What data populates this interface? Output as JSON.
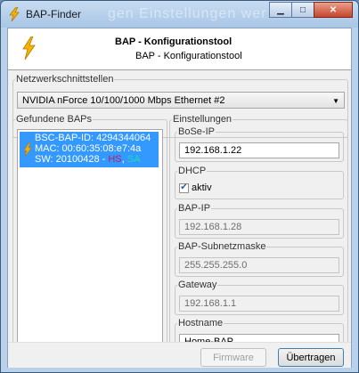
{
  "window": {
    "title": "BAP-Finder",
    "ghost_text": "gen Einstellungen wer"
  },
  "header": {
    "title": "BAP - Konfigurationstool",
    "subtitle": "BAP - Konfigurationstool"
  },
  "network": {
    "legend": "Netzwerkschnittstellen",
    "selected": "NVIDIA nForce 10/100/1000 Mbps Ethernet #2"
  },
  "found": {
    "legend": "Gefundene BAPs",
    "items": [
      {
        "id_line": "BSC-BAP-ID: 4294344064",
        "mac_line": "MAC: 00:60:35:08:e7:4a",
        "sw_prefix": "SW: 20100428 - ",
        "hs": "HS",
        "sep": ", ",
        "sa": "SA"
      }
    ]
  },
  "settings": {
    "legend": "Einstellungen",
    "bose_ip": {
      "label": "BoSe-IP",
      "value": "192.168.1.22"
    },
    "dhcp": {
      "label": "DHCP",
      "checkbox_label": "aktiv",
      "checked": true
    },
    "bap_ip": {
      "label": "BAP-IP",
      "value": "192.168.1.28"
    },
    "bap_mask": {
      "label": "BAP-Subnetzmaske",
      "value": "255.255.255.0"
    },
    "gateway": {
      "label": "Gateway",
      "value": "192.168.1.1"
    },
    "hostname": {
      "label": "Hostname",
      "value": "Home-BAP"
    }
  },
  "buttons": {
    "firmware": "Firmware",
    "transfer": "Übertragen"
  },
  "icons": {
    "app": "lightning-bolt-icon",
    "minimize": "minimize-icon",
    "maximize": "maximize-icon",
    "close": "close-icon"
  },
  "colors": {
    "selection": "#3399ff",
    "hs": "#c0186a",
    "sa": "#16e0b0",
    "bolt": "#f5b400"
  }
}
